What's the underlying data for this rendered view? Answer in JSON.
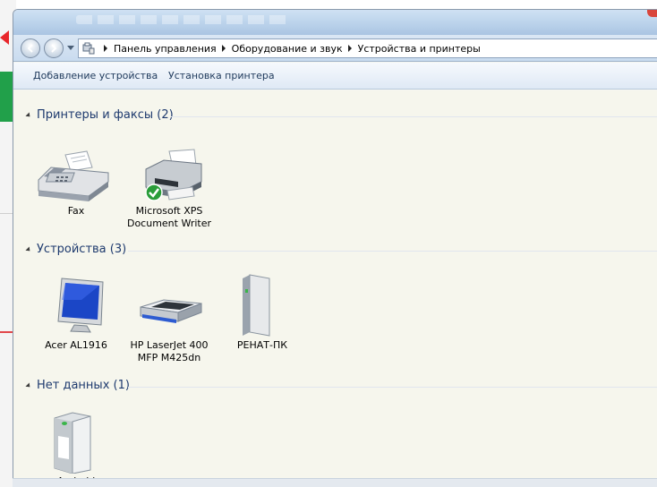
{
  "breadcrumbs": [
    "Панель управления",
    "Оборудование и звук",
    "Устройства и принтеры"
  ],
  "toolbar": {
    "add_device": "Добавление устройства",
    "install_printer": "Установка принтера"
  },
  "groups": [
    {
      "title": "Принтеры и факсы (2)",
      "items": [
        {
          "label": "Fax",
          "icon": "fax-icon"
        },
        {
          "label": "Microsoft XPS Document Writer",
          "icon": "printer-default-icon"
        }
      ]
    },
    {
      "title": "Устройства (3)",
      "items": [
        {
          "label": "Acer AL1916",
          "icon": "monitor-icon"
        },
        {
          "label": "HP LaserJet 400 MFP M425dn",
          "icon": "scanner-icon"
        },
        {
          "label": "РЕНАТ-ПК",
          "icon": "computer-icon"
        }
      ]
    },
    {
      "title": "Нет данных (1)",
      "items": [
        {
          "label": "Android",
          "icon": "external-drive-icon"
        }
      ]
    }
  ],
  "colors": {
    "group_header": "#1e3a6e",
    "toolbar_text": "#1e395b",
    "accent_green": "#21a04a",
    "accent_red": "#e8262b"
  }
}
